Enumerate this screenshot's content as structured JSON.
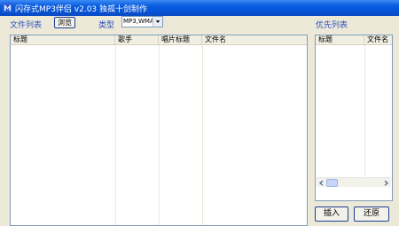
{
  "window": {
    "title": "闪存式MP3伴侣 v2.03 独孤十剑制作"
  },
  "toolbar": {
    "file_list_label": "文件列表",
    "browse_button": "浏览",
    "type_label": "类型",
    "type_value": "MP3,WMA",
    "priority_label": "优先列表"
  },
  "file_list": {
    "columns": [
      "标题",
      "歌手",
      "唱片标题",
      "文件名"
    ],
    "rows": []
  },
  "priority_list": {
    "columns": [
      "标题",
      "文件名"
    ],
    "rows": []
  },
  "actions": {
    "insert_button": "插入",
    "restore_button": "还原"
  }
}
